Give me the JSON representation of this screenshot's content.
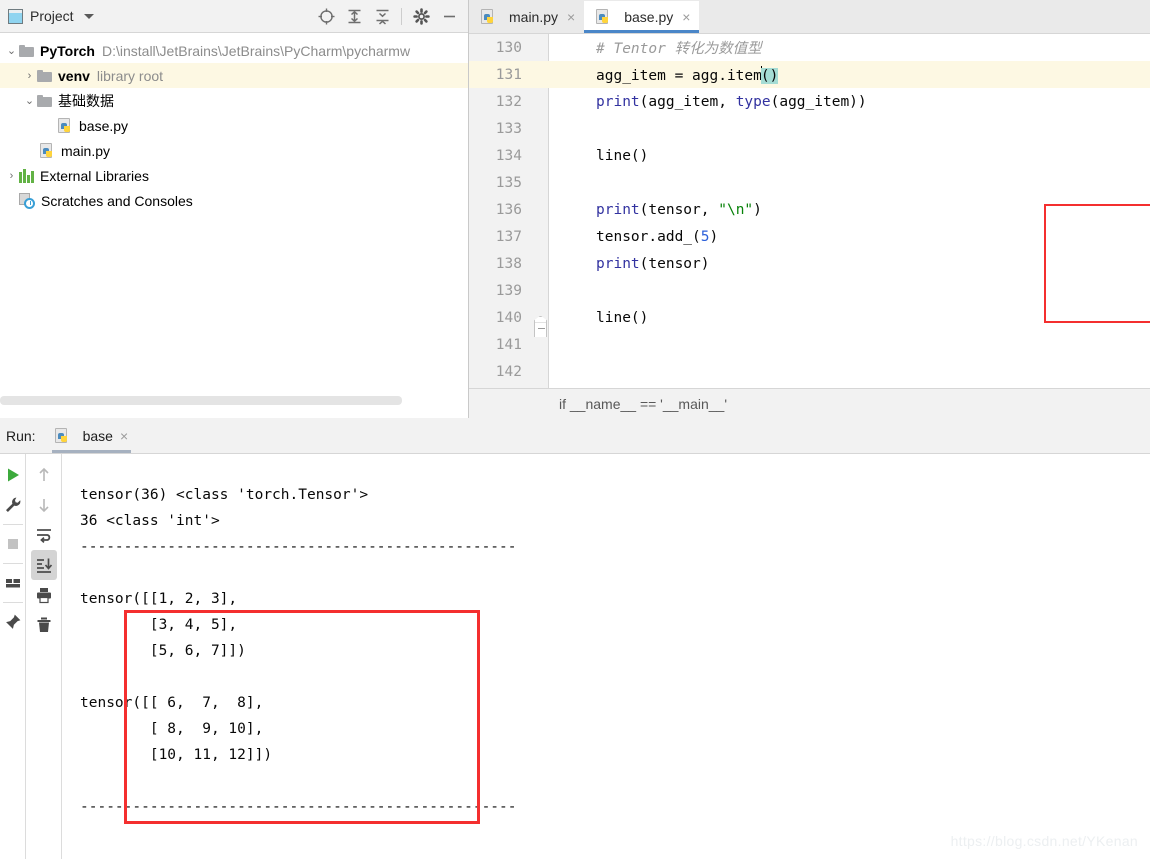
{
  "project_panel": {
    "title": "Project",
    "icons": [
      "project-window-icon",
      "chevron-down-icon",
      "locate-target-icon",
      "expand-all-icon",
      "collapse-all-icon",
      "settings-gear-icon",
      "hide-minimize-icon"
    ],
    "tree": [
      {
        "name": "PyTorch",
        "secondary": "D:\\install\\JetBrains\\JetBrains\\PyCharm\\pycharmw",
        "arrow": "⌄",
        "icon": "folder-icon",
        "indent": 0,
        "bold": true,
        "highlighted": false
      },
      {
        "name": "venv",
        "secondary": "library root",
        "arrow": "›",
        "icon": "folder-icon",
        "indent": 1,
        "bold": true,
        "highlighted": true
      },
      {
        "name": "基础数据",
        "secondary": "",
        "arrow": "⌄",
        "icon": "folder-icon",
        "indent": 1,
        "bold": false,
        "highlighted": false
      },
      {
        "name": "base.py",
        "secondary": "",
        "arrow": "",
        "icon": "python-file-icon",
        "indent": 2,
        "bold": false,
        "highlighted": false
      },
      {
        "name": "main.py",
        "secondary": "",
        "arrow": "",
        "icon": "python-file-icon",
        "indent": 1,
        "bold": false,
        "highlighted": false
      },
      {
        "name": "External Libraries",
        "secondary": "",
        "arrow": "›",
        "icon": "external-libraries-icon",
        "indent": 0,
        "bold": false,
        "highlighted": false
      },
      {
        "name": "Scratches and Consoles",
        "secondary": "",
        "arrow": "",
        "icon": "scratches-icon",
        "indent": 0,
        "bold": false,
        "highlighted": false
      }
    ]
  },
  "editor": {
    "tabs": [
      {
        "label": "main.py",
        "active": false,
        "close": "×"
      },
      {
        "label": "base.py",
        "active": true,
        "close": "×"
      }
    ],
    "lines": [
      {
        "num": "130",
        "current": false,
        "fold": false,
        "html": "<span class=\"kw-cmt\"># Tentor 转化为数值型</span>"
      },
      {
        "num": "131",
        "current": true,
        "fold": false,
        "html": "agg_item = agg.item<span class=\"caret\"></span><span class=\"sel-paren\">()</span>"
      },
      {
        "num": "132",
        "current": false,
        "fold": false,
        "html": "<span class=\"kw-fn\">print</span>(agg_item, <span class=\"kw-fn\">type</span>(agg_item))"
      },
      {
        "num": "133",
        "current": false,
        "fold": false,
        "html": ""
      },
      {
        "num": "134",
        "current": false,
        "fold": false,
        "html": "line()"
      },
      {
        "num": "135",
        "current": false,
        "fold": false,
        "html": ""
      },
      {
        "num": "136",
        "current": false,
        "fold": false,
        "html": "<span class=\"kw-fn\">print</span>(tensor, <span class=\"kw-str\">\"\\n\"</span>)"
      },
      {
        "num": "137",
        "current": false,
        "fold": false,
        "html": "tensor.add_(<span class=\"kw-num\">5</span>)"
      },
      {
        "num": "138",
        "current": false,
        "fold": false,
        "html": "<span class=\"kw-fn\">print</span>(tensor)"
      },
      {
        "num": "139",
        "current": false,
        "fold": false,
        "html": ""
      },
      {
        "num": "140",
        "current": false,
        "fold": true,
        "html": "line()"
      },
      {
        "num": "141",
        "current": false,
        "fold": false,
        "html": ""
      },
      {
        "num": "142",
        "current": false,
        "fold": false,
        "html": ""
      }
    ],
    "breadcrumb": "if __name__ == '__main__'",
    "highlight_color": "#f42f2f",
    "caret_line_color": "#fdf8e3",
    "selection_color": "#a5dcd4"
  },
  "run_panel": {
    "label": "Run:",
    "tab_name": "base",
    "tab_close": "×",
    "toolbar_left": [
      "run-icon",
      "wrench-settings-icon",
      "stop-icon",
      "layout-icon",
      "pin-tab-icon"
    ],
    "toolbar_right": [
      "arrow-up-icon",
      "arrow-down-icon",
      "soft-wrap-icon",
      "scroll-to-end-icon",
      "print-icon",
      "trash-icon"
    ],
    "console_lines": [
      "tensor(36) <class 'torch.Tensor'>",
      "36 <class 'int'>",
      "--------------------------------------------------",
      "",
      "tensor([[1, 2, 3],",
      "        [3, 4, 5],",
      "        [5, 6, 7]])",
      "",
      "tensor([[ 6,  7,  8],",
      "        [ 8,  9, 10],",
      "        [10, 11, 12]])",
      "",
      "--------------------------------------------------"
    ]
  },
  "watermark": "https://blog.csdn.net/YKenan"
}
